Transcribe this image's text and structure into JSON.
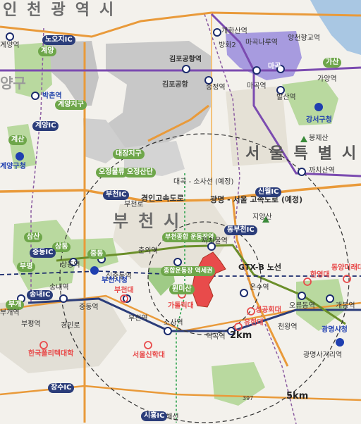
{
  "regions": {
    "incheon": "인천광역시",
    "seoul": "서울특별시",
    "bucheon": "부천시",
    "gyeyang_partial": "양구"
  },
  "areas": {
    "gimpo_airport": "김포공항",
    "gyeyang_district": "계양지구",
    "daejang_district": "대장지구",
    "ogok_district": "오곡지구",
    "ojeong_logistics": "오정물류",
    "ojeong_industrial": "오정산단",
    "bucheon_sports": "부천종합 운동장역",
    "sports_complex": "종합운동장 역세권",
    "wonmisan": "원미산",
    "gyesan": "계산",
    "samsan": "삼산",
    "sangdong": "상동",
    "jungdong": "중동",
    "bupyeong": "부평",
    "bugae": "부개",
    "gyeyang_area": "계양",
    "gasan": "가산",
    "gwangmyeong_station_area": "소사"
  },
  "roads": {
    "gyeongin_expressway": "경인고속도로",
    "gwangmyeong_seoul_expressway": "광명 - 서울 고속도로 (예정)",
    "daegok_sosa": "대곡 - 소사선 (예정)",
    "gtx_b": "GTX-B 노선",
    "gyeongin_ro": "경인로",
    "bucheon_ro": "부천로",
    "ogjeong_ro": "오정로",
    "gimpo_expressway_label": "김포공항로",
    "seohae_line": "서해선",
    "road_397": "397"
  },
  "interchanges": [
    {
      "id": "nohoji",
      "label": "노오지IC"
    },
    {
      "id": "gyeyang",
      "label": "계양IC"
    },
    {
      "id": "bucheon",
      "label": "부천IC"
    },
    {
      "id": "sinwol",
      "label": "신월IC"
    },
    {
      "id": "dongbucheon",
      "label": "동부천IC"
    },
    {
      "id": "jungdong",
      "label": "중동IC"
    },
    {
      "id": "songnae",
      "label": "송내IC"
    },
    {
      "id": "jangsu",
      "label": "장수IC"
    },
    {
      "id": "siheung",
      "label": "시흥IC"
    }
  ],
  "stations": [
    {
      "id": "bakchon",
      "label": "박촌역"
    },
    {
      "id": "gyeyang",
      "label": "계양역"
    },
    {
      "id": "gimpo_airport",
      "label": "김포공항역"
    },
    {
      "id": "gaehwasan",
      "label": "개화산역"
    },
    {
      "id": "banghwa",
      "label": "방화2"
    },
    {
      "id": "magongnaru",
      "label": "마곡나루역"
    },
    {
      "id": "magok",
      "label": "마곡"
    },
    {
      "id": "magok_station",
      "label": "마곡역"
    },
    {
      "id": "songjeong",
      "label": "송정역"
    },
    {
      "id": "balsan",
      "label": "발산역"
    },
    {
      "id": "yangcheon",
      "label": "양천향교역"
    },
    {
      "id": "gayang",
      "label": "가양역"
    },
    {
      "id": "kkachisan",
      "label": "까치산역"
    },
    {
      "id": "kkachiul",
      "label": "까치울역"
    },
    {
      "id": "chunui",
      "label": "춘의역"
    },
    {
      "id": "sindeung",
      "label": "신중동역"
    },
    {
      "id": "sangdong_st",
      "label": "상동역"
    },
    {
      "id": "jungdong_st",
      "label": "중동역"
    },
    {
      "id": "songnae",
      "label": "송내역"
    },
    {
      "id": "bucheon_st",
      "label": "부천역"
    },
    {
      "id": "sosa",
      "label": "소사역"
    },
    {
      "id": "yeokgok",
      "label": "역곡역"
    },
    {
      "id": "onsu",
      "label": "온수역"
    },
    {
      "id": "oryu",
      "label": "오류동역"
    },
    {
      "id": "gaebong",
      "label": "개봉역"
    },
    {
      "id": "cheonwang",
      "label": "천왕역"
    },
    {
      "id": "gwangmyeong_sageori",
      "label": "광명사거리역"
    },
    {
      "id": "bugae_st",
      "label": "부개역"
    },
    {
      "id": "bupyeong_st",
      "label": "부평역"
    }
  ],
  "city_halls": [
    {
      "id": "gyeyang_gu",
      "label": "계양구청"
    },
    {
      "id": "bucheon",
      "label": "부천시청"
    },
    {
      "id": "gangseo",
      "label": "강서구청"
    },
    {
      "id": "gwangmyeong",
      "label": "광명시청"
    }
  ],
  "universities": [
    {
      "id": "bucheon_univ",
      "label": "부천대"
    },
    {
      "id": "catholic",
      "label": "가톨릭대"
    },
    {
      "id": "sungkonghoe",
      "label": "성공회대"
    },
    {
      "id": "yuhan",
      "label": "유한대"
    },
    {
      "id": "hanyang",
      "label": "한영대"
    },
    {
      "id": "dongyang",
      "label": "동양미래대"
    },
    {
      "id": "seoul_sinhak",
      "label": "서울신학대"
    },
    {
      "id": "polytech",
      "label": "한국폴리텍대학"
    }
  ],
  "mountains": [
    {
      "id": "bongjesan",
      "label": "봉제산"
    },
    {
      "id": "jiyangsan",
      "label": "지양산"
    },
    {
      "id": "hwaebaesan",
      "label": "매봉산"
    }
  ],
  "radius_labels": {
    "r2": "2km",
    "r5": "5km"
  },
  "green_labels": [
    "원흥",
    "철산",
    "두산",
    "마곡",
    "가양",
    "서운",
    "계산",
    "삼산",
    "상동",
    "중동",
    "부평",
    "부개",
    "계양",
    "동양",
    "천왕2",
    "천왕",
    "항동",
    "옥길",
    "등촌",
    "천왕2"
  ],
  "colors": {
    "site": "#e84b4b",
    "university": "#e84b4b",
    "station_outline": "#1a2a6c",
    "city_hall": "#1f3fb0",
    "green_zone": "#b7d79b",
    "grey_zone": "#b3b3b3",
    "purple_zone": "#9b8cd6"
  }
}
